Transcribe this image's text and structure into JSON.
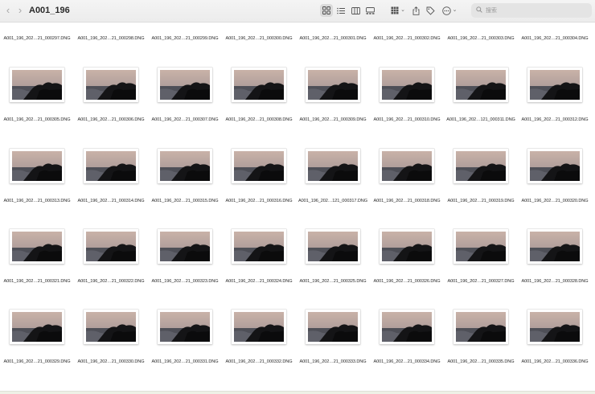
{
  "window": {
    "title": "A001_196",
    "back_icon": "chevron-left-icon",
    "forward_icon": "chevron-right-icon"
  },
  "toolbar": {
    "view_modes": [
      "icon-view-icon",
      "list-view-icon",
      "column-view-icon",
      "gallery-view-icon"
    ],
    "active_view": "icon-view-icon",
    "group_icon": "group-grid-icon",
    "share_icon": "share-icon",
    "tag_icon": "tag-icon",
    "more_icon": "ellipsis-circle-icon"
  },
  "search": {
    "placeholder": "搜索",
    "value": ""
  },
  "files": {
    "rows": [
      [
        "A001_196_202…21_000297.DNG",
        "A001_196_202…21_000298.DNG",
        "A001_196_202…21_000299.DNG",
        "A001_196_202…21_000300.DNG",
        "A001_196_202…21_000301.DNG",
        "A001_196_202…21_000302.DNG",
        "A001_196_202…21_000303.DNG",
        "A001_196_202…21_000304.DNG"
      ],
      [
        "A001_196_202…21_000305.DNG",
        "A001_196_202…21_000306.DNG",
        "A001_196_202…21_000307.DNG",
        "A001_196_202…21_000308.DNG",
        "A001_196_202…21_000309.DNG",
        "A001_196_202…21_000310.DNG",
        "A001_196_202…121_000311.DNG",
        "A001_196_202…21_000312.DNG"
      ],
      [
        "A001_196_202…21_000313.DNG",
        "A001_196_202…21_000314.DNG",
        "A001_196_202…21_000315.DNG",
        "A001_196_202…21_000316.DNG",
        "A001_196_202…121_000317.DNG",
        "A001_196_202…21_000318.DNG",
        "A001_196_202…21_000319.DNG",
        "A001_196_202…21_000320.DNG"
      ],
      [
        "A001_196_202…21_000321.DNG",
        "A001_196_202…21_000322.DNG",
        "A001_196_202…21_000323.DNG",
        "A001_196_202…21_000324.DNG",
        "A001_196_202…21_000325.DNG",
        "A001_196_202…21_000326.DNG",
        "A001_196_202…21_000327.DNG",
        "A001_196_202…21_000328.DNG"
      ],
      [
        "A001_196_202…21_000329.DNG",
        "A001_196_202…21_000330.DNG",
        "A001_196_202…21_000331.DNG",
        "A001_196_202…21_000332.DNG",
        "A001_196_202…21_000333.DNG",
        "A001_196_202…21_000334.DNG",
        "A001_196_202…21_000335.DNG",
        "A001_196_202…21_000336.DNG"
      ]
    ],
    "thumbnail_icon": "dusk-landscape-photo-thumbnail",
    "colors": {
      "sky_top": "#c9b2a8",
      "sky_bottom": "#9c8f91",
      "sea": "#4e4f57",
      "land": "#141416"
    }
  }
}
